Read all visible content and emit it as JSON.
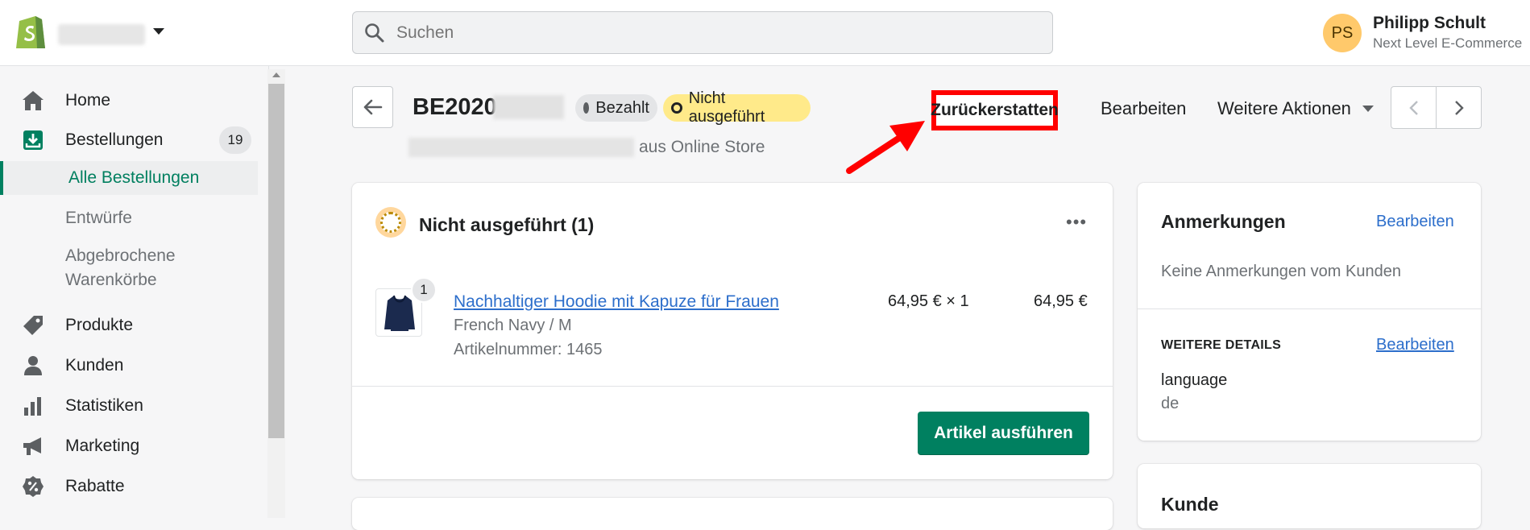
{
  "header": {
    "search_placeholder": "Suchen",
    "user_name": "Philipp Schult",
    "user_initials": "PS",
    "user_shop": "Next Level E-Commerce"
  },
  "sidebar": {
    "items": [
      {
        "label": "Home",
        "icon": "home-icon"
      },
      {
        "label": "Bestellungen",
        "icon": "orders-icon",
        "count": "19"
      },
      {
        "label": "Produkte",
        "icon": "tag-icon"
      },
      {
        "label": "Kunden",
        "icon": "person-icon"
      },
      {
        "label": "Statistiken",
        "icon": "bar-chart-icon"
      },
      {
        "label": "Marketing",
        "icon": "megaphone-icon"
      },
      {
        "label": "Rabatte",
        "icon": "discount-icon"
      }
    ],
    "sub_items": [
      "Alle Bestellungen",
      "Entwürfe",
      "Abgebrochene",
      "Warenkörbe"
    ]
  },
  "order": {
    "id_prefix": "BE2020",
    "payment_status": "Bezahlt",
    "fulfillment_status": "Nicht ausgeführt",
    "source_suffix": "aus Online Store"
  },
  "actions": {
    "refund": "Zurückerstatten",
    "edit": "Bearbeiten",
    "more": "Weitere Aktionen"
  },
  "fulfillment_card": {
    "title": "Nicht ausgeführt (1)",
    "menu": "•••",
    "item": {
      "quantity": "1",
      "name": "Nachhaltiger Hoodie mit Kapuze für Frauen",
      "variant": "French Navy / M",
      "sku": "Artikelnummer: 1465",
      "unit_price": "64,95 € × 1",
      "total": "64,95 €"
    },
    "button": "Artikel ausführen"
  },
  "notes_card": {
    "title": "Anmerkungen",
    "edit": "Bearbeiten",
    "empty": "Keine Anmerkungen vom Kunden",
    "details_heading": "WEITERE DETAILS",
    "details_edit": "Bearbeiten",
    "details_key": "language",
    "details_value": "de"
  },
  "customer_card": {
    "title": "Kunde"
  },
  "colors": {
    "brand_green": "#008060",
    "highlight_red": "#ff0000",
    "link_blue": "#2c6ecb",
    "status_yellow": "#ffea8a"
  }
}
